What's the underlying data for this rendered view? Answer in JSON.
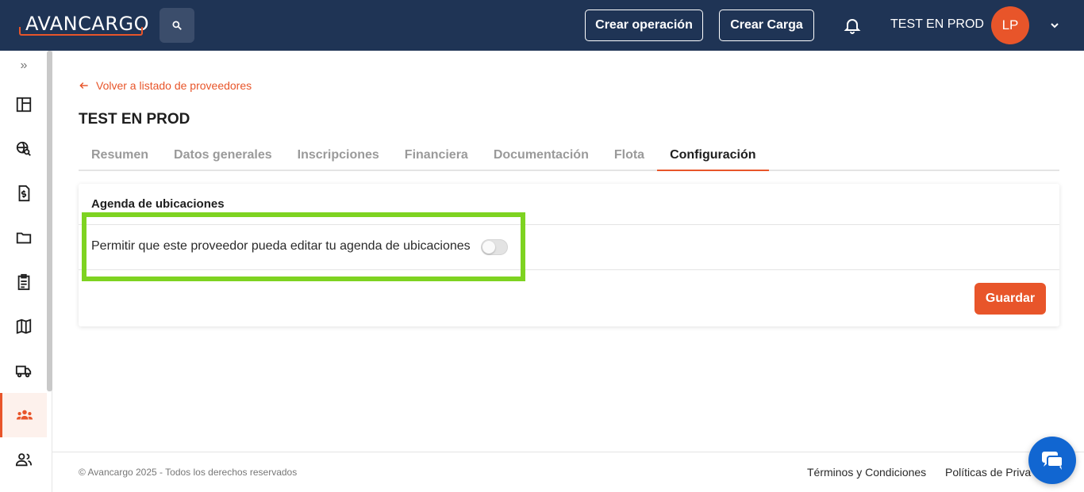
{
  "header": {
    "logo_text": "AVANCARGO",
    "create_operation_label": "Crear operación",
    "create_load_label": "Crear Carga",
    "user_name": "TEST EN PROD",
    "avatar_initials": "LP"
  },
  "sidebar": {
    "expand_glyph": "»",
    "items": [
      {
        "icon": "dashboard-icon"
      },
      {
        "icon": "globe-search-icon"
      },
      {
        "icon": "invoice-dollar-icon"
      },
      {
        "icon": "folder-icon"
      },
      {
        "icon": "clipboard-icon"
      },
      {
        "icon": "map-icon"
      },
      {
        "icon": "truck-icon"
      },
      {
        "icon": "group-icon",
        "active": true
      },
      {
        "icon": "users-icon"
      }
    ]
  },
  "main": {
    "back_link": "Volver a listado de proveedores",
    "title": "TEST EN PROD",
    "tabs": [
      {
        "label": "Resumen"
      },
      {
        "label": "Datos generales"
      },
      {
        "label": "Inscripciones"
      },
      {
        "label": "Financiera"
      },
      {
        "label": "Documentación"
      },
      {
        "label": "Flota"
      },
      {
        "label": "Configuración",
        "active": true
      }
    ],
    "card": {
      "title": "Agenda de ubicaciones",
      "setting_label": "Permitir que este proveedor pueda editar tu agenda de ubicaciones",
      "setting_enabled": false,
      "save_label": "Guardar"
    }
  },
  "footer": {
    "copyright": "© Avancargo 2025 - Todos los derechos reservados",
    "terms": "Términos y Condiciones",
    "privacy": "Políticas de Priva"
  },
  "colors": {
    "brand": "#e8552a",
    "header_bg": "#1f3455",
    "highlight": "#7ed321",
    "chat": "#1166d1"
  }
}
